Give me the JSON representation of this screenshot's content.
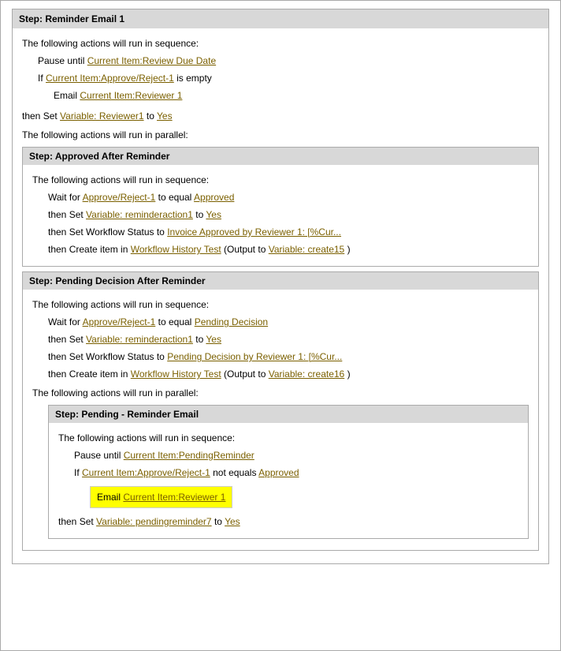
{
  "page": {
    "step_reminder_email_1": {
      "header": "Step: Reminder Email 1",
      "actions_sequence": "The following actions will run in sequence:",
      "pause_until": "Pause until",
      "pause_link": "Current Item:Review Due Date",
      "if_text": "If",
      "if_link": "Current Item:Approve/Reject-1",
      "is_empty": "is empty",
      "email_text": "Email",
      "email_link": "Current Item:Reviewer 1",
      "then_set": "then Set",
      "variable_link": "Variable: Reviewer1",
      "to": "to",
      "yes_link": "Yes",
      "actions_parallel": "The following actions will run in parallel:"
    },
    "step_approved_after_reminder": {
      "header": "Step: Approved After Reminder",
      "actions_sequence": "The following actions will run in sequence:",
      "wait_for": "Wait for",
      "wait_link": "Approve/Reject-1",
      "to_equal": "to equal",
      "approved_link": "Approved",
      "then_set1": "then Set",
      "var1_link": "Variable: reminderaction1",
      "to1": "to",
      "yes1_link": "Yes",
      "then_set2": "then Set Workflow Status to",
      "status_link": "Invoice Approved by Reviewer 1: [%Cur...",
      "then_create": "then Create item in",
      "create_link": "Workflow History Test",
      "output_text": "(Output to",
      "var_create_link": "Variable: create15",
      "close_paren": ")"
    },
    "step_pending_decision_after_reminder": {
      "header": "Step: Pending Decision After Reminder",
      "actions_sequence": "The following actions will run in sequence:",
      "wait_for": "Wait for",
      "wait_link": "Approve/Reject-1",
      "to_equal": "to equal",
      "pending_link": "Pending Decision",
      "then_set1": "then Set",
      "var1_link": "Variable: reminderaction1",
      "to1": "to",
      "yes1_link": "Yes",
      "then_set2": "then Set Workflow Status to",
      "status_link": "Pending Decision by Reviewer 1: [%Cur...",
      "then_create": "then Create item in",
      "create_link": "Workflow History Test",
      "output_text": "(Output to",
      "var_create_link": "Variable: create16",
      "close_paren": ")",
      "actions_parallel": "The following actions will run in parallel:"
    },
    "step_pending_reminder_email": {
      "header": "Step: Pending - Reminder Email",
      "actions_sequence": "The following actions will run in sequence:",
      "pause_until": "Pause until",
      "pause_link": "Current Item:PendingReminder",
      "if_text": "If",
      "if_link": "Current Item:Approve/Reject-1",
      "not_equals": "not equals",
      "approved_link": "Approved",
      "email_text": "Email",
      "email_link": "Current Item:Reviewer 1",
      "then_set": "then Set",
      "var_link": "Variable: pendingreminder7",
      "to": "to",
      "yes_link": "Yes"
    }
  }
}
